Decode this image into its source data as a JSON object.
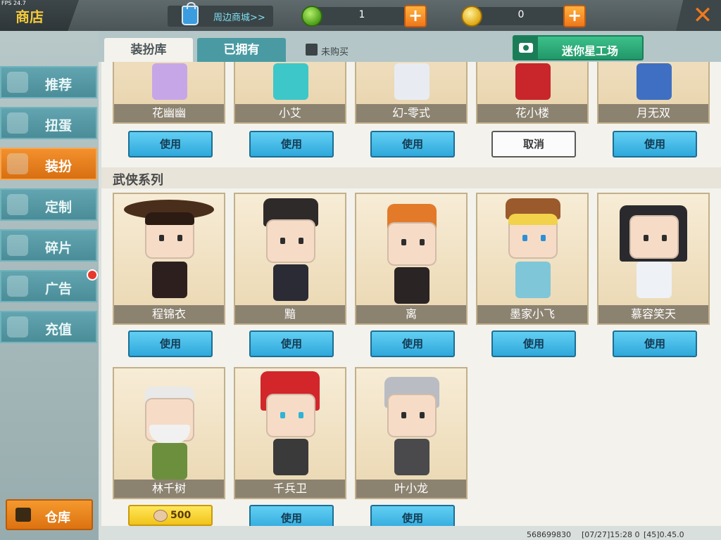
{
  "fps": "FPS 24.7",
  "header": {
    "title": "商店",
    "mall_label": "周边商城>>",
    "gems": "1",
    "coins": "0",
    "close_symbol": "✕"
  },
  "sidebar": {
    "items": [
      {
        "label": "推荐",
        "icon": "thumbs-up-icon"
      },
      {
        "label": "扭蛋",
        "icon": "capsule-icon"
      },
      {
        "label": "装扮",
        "icon": "shirt-icon",
        "active": true
      },
      {
        "label": "定制",
        "icon": "pencil-icon"
      },
      {
        "label": "碎片",
        "icon": "puzzle-icon"
      },
      {
        "label": "广告",
        "icon": "gift-icon",
        "badge": true
      },
      {
        "label": "充值",
        "icon": "coins-icon"
      }
    ],
    "warehouse_label": "仓库"
  },
  "tabs": {
    "wardrobe": "装扮库",
    "owned": "已拥有",
    "unbought": "未购买",
    "workshop": "迷你星工场"
  },
  "top_row": [
    {
      "name": "花幽幽",
      "action": "使用"
    },
    {
      "name": "小艾",
      "action": "使用"
    },
    {
      "name": "幻-零式",
      "action": "使用"
    },
    {
      "name": "花小楼",
      "action": "取消"
    },
    {
      "name": "月无双",
      "action": "使用"
    }
  ],
  "section": {
    "title": "武侠系列",
    "row1": [
      {
        "name": "程锦衣",
        "action": "使用"
      },
      {
        "name": "黯",
        "action": "使用"
      },
      {
        "name": "离",
        "action": "使用"
      },
      {
        "name": "墨家小飞",
        "action": "使用"
      },
      {
        "name": "慕容笑天",
        "action": "使用"
      }
    ],
    "row2": [
      {
        "name": "林千树",
        "price": "500"
      },
      {
        "name": "千兵卫",
        "action": "使用"
      },
      {
        "name": "叶小龙",
        "action": "使用"
      }
    ]
  },
  "footer": {
    "uid": "568699830",
    "time": "[07/27]15:28 0",
    "version": "[45]0.45.0"
  },
  "colors": {
    "accent_orange": "#f07a1c",
    "use_button_blue": "#2ea8db",
    "workshop_green": "#22986a",
    "sidebar_teal": "#4a8d98"
  }
}
